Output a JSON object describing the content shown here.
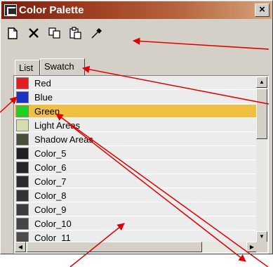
{
  "window": {
    "title": "Color Palette",
    "close_glyph": "×",
    "accent": "#8b2a12"
  },
  "toolbar": {
    "buttons": [
      {
        "name": "new-icon"
      },
      {
        "name": "delete-icon"
      },
      {
        "name": "copy-icon"
      },
      {
        "name": "paste-icon"
      },
      {
        "name": "eyedropper-icon"
      }
    ]
  },
  "tabs": [
    {
      "label": "List"
    },
    {
      "label": "Swatch"
    }
  ],
  "colors": [
    {
      "label": "Red",
      "color": "#e02020"
    },
    {
      "label": "Blue",
      "color": "#2030c0"
    },
    {
      "label": "Green",
      "color": "#20d020"
    },
    {
      "label": "Light Areas",
      "color": "#d8ddb0"
    },
    {
      "label": "Shadow Areas",
      "color": "#4a4f38"
    },
    {
      "label": "Color_5",
      "color": "#202020"
    },
    {
      "label": "Color_6",
      "color": "#262626"
    },
    {
      "label": "Color_7",
      "color": "#2c2c2c"
    },
    {
      "label": "Color_8",
      "color": "#333333"
    },
    {
      "label": "Color_9",
      "color": "#3c3c3c"
    },
    {
      "label": "Color_10",
      "color": "#454545"
    },
    {
      "label": "Color_11",
      "color": "#4c4c4c"
    }
  ],
  "selected_index": 2,
  "annotation_color": "#e00000"
}
